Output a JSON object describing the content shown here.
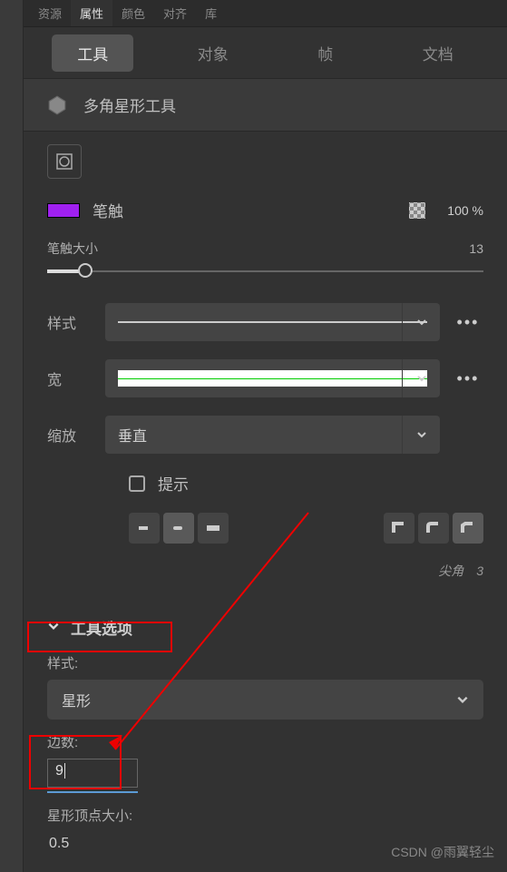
{
  "top_tabs": {
    "resources": "资源",
    "properties": "属性",
    "color": "颜色",
    "align": "对齐",
    "library": "库"
  },
  "mode_tabs": {
    "tool": "工具",
    "object": "对象",
    "frame": "帧",
    "document": "文档"
  },
  "tool_name": "多角星形工具",
  "stroke": {
    "label": "笔触",
    "opacity": "100 %",
    "color_hex": "#a020f0"
  },
  "stroke_size": {
    "label": "笔触大小",
    "value": "13"
  },
  "style_label": "样式",
  "width_label": "宽",
  "scale": {
    "label": "缩放",
    "value": "垂直"
  },
  "hint_label": "提示",
  "corner": {
    "label": "尖角",
    "value": "3"
  },
  "tool_options_title": "工具选项",
  "options": {
    "style_label": "样式:",
    "style_value": "星形",
    "sides_label": "边数:",
    "sides_value": "9",
    "point_size_label": "星形顶点大小:",
    "point_size_value": "0.5"
  },
  "watermark": "CSDN @雨翼轻尘"
}
